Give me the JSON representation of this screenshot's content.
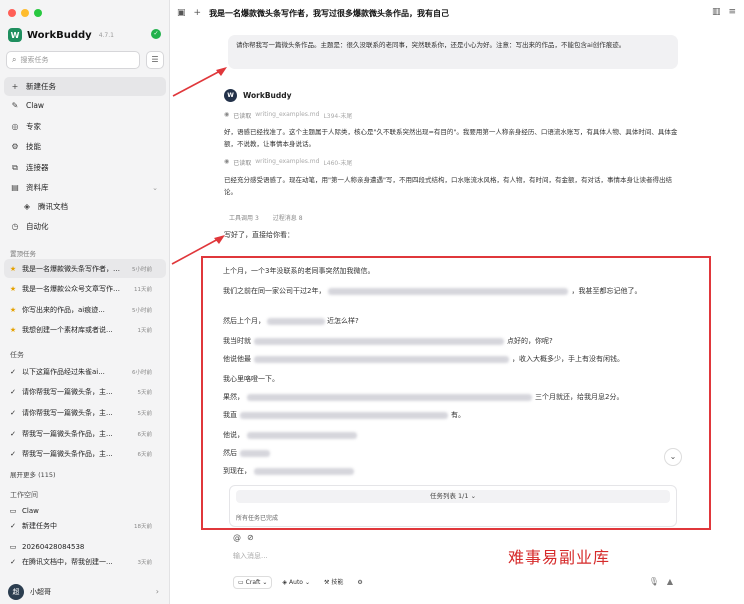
{
  "sidebar": {
    "brand": "WorkBuddy",
    "version": "4.7.1",
    "search_placeholder": "搜索任务",
    "nav": [
      {
        "label": "新建任务",
        "icon": "plus-icon"
      },
      {
        "label": "Claw",
        "icon": "claw-icon"
      },
      {
        "label": "专家",
        "icon": "expert-icon"
      },
      {
        "label": "技能",
        "icon": "skill-icon"
      },
      {
        "label": "连接器",
        "icon": "connector-icon"
      },
      {
        "label": "资料库",
        "icon": "library-icon"
      },
      {
        "label": "腾讯文档",
        "icon": "doc-icon"
      },
      {
        "label": "自动化",
        "icon": "automation-icon"
      }
    ],
    "recurring_title": "置顶任务",
    "recurring": [
      {
        "title": "我是一名爆款微头条写作者，我可以...",
        "time": "5小时前"
      },
      {
        "title": "我是一名爆款公众号文章写作者...",
        "time": "11天前"
      },
      {
        "title": "你写出来的作品，ai痕迹...",
        "time": "5小时前"
      },
      {
        "title": "我想创建一个素材库或者说...",
        "time": "1天前"
      }
    ],
    "tasks_title": "任务",
    "tasks": [
      {
        "title": "以下这篇作品经过朱雀ai...",
        "time": "6小时前"
      },
      {
        "title": "请你帮我写一篇微头条，主...",
        "time": "5天前"
      },
      {
        "title": "请你帮我写一篇微头条，主...",
        "time": "5天前"
      },
      {
        "title": "帮我写一篇微头条作品，主...",
        "time": "6天前"
      },
      {
        "title": "帮我写一篇微头条作品，主...",
        "time": "6天前"
      }
    ],
    "more": "展开更多 (115)",
    "workspace_title": "工作空间",
    "workspace": [
      {
        "title": "Claw",
        "time": ""
      },
      {
        "title": "新建任务中",
        "time": "18天前"
      },
      {
        "title": "20260428084538",
        "time": ""
      },
      {
        "title": "在腾讯文档中，帮我创建一...",
        "time": "3天前"
      }
    ],
    "user": "小超哥"
  },
  "main": {
    "title": "我是一名爆款微头条写作者，我写过很多爆款微头条作品，我有自己",
    "user_message": "请你帮我写一篇微头条作品。主题是：很久没联系的老同事，突然联系你，还是小心为好。注意：写出来的作品，不能包含ai创作痕迹。",
    "bot_name": "WorkBuddy",
    "read1_label": "已读取",
    "read1_file": "writing_examples.md",
    "read1_range": "L394-末尾",
    "para1": "好，语感已经找准了。这个主题属于人际类，核心是\"久不联系突然出现=有目的\"。我要用第一人称亲身经历、口语流水账写，有具体人物、具体时间、具体金额，不说教，让事情本身说话。",
    "read2_label": "已读取",
    "read2_file": "writing_examples.md",
    "read2_range": "L460-末尾",
    "para2": "已经充分感受语感了。现在动笔，用\"第一人称亲身遭遇\"写，不用四段式结构，口水账流水风格，有人物，有时间，有金额，有对话，事情本身让读者得出结论。",
    "tool_call": "工具调用",
    "tool_count": "3",
    "process": "过程消息",
    "process_count": "8",
    "reply_intro": "写好了，直接给你看：",
    "draft": [
      {
        "pre": "上个月，一个3年没联系的老同事突然加我微信。",
        "post": ""
      },
      {
        "pre": "我们之前在同一家公司干过2年，",
        "post": "，我甚至都忘记他了。"
      },
      {
        "pre": "然后上个月，",
        "post": "近怎么样?"
      },
      {
        "pre": "我当时就",
        "post": "点好的，你呢?"
      },
      {
        "pre": "他说他最",
        "post": "，收入大概多少，手上有没有闲钱。"
      },
      {
        "pre": "我心里咯噔一下。",
        "post": ""
      },
      {
        "pre": "果然，",
        "post": "三个月就还，给我月息2分。"
      },
      {
        "pre": "我直",
        "post": "有。"
      },
      {
        "pre": "他说，",
        "post": ""
      },
      {
        "pre": "然后",
        "post": ""
      },
      {
        "pre": "到现在，",
        "post": ""
      }
    ],
    "tasklist_title": "任务列表 1/1",
    "tasklist_status": "所有任务已完成",
    "composer_placeholder": "输入消息...",
    "mode": "Craft",
    "auto": "Auto",
    "skills": "技能"
  },
  "watermark": "难事易副业库",
  "colors": {
    "accent": "#e0373b",
    "brand": "#1f8f5f",
    "ok": "#22b14c"
  }
}
